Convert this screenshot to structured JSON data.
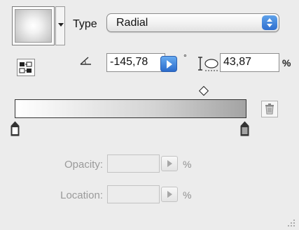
{
  "gradient": {
    "type_label": "Type",
    "type_value": "Radial",
    "angle_value": "-145,78",
    "angle_unit": "°",
    "radius_value": "43,87",
    "radius_unit": "%",
    "stops": [
      {
        "color": "#ffffff",
        "location_percent": 0
      },
      {
        "color": "#a3a3a3",
        "location_percent": 100
      }
    ],
    "midpoint_percent": 82
  },
  "stop_editor": {
    "opacity_label": "Opacity:",
    "opacity_value": "",
    "opacity_unit": "%",
    "location_label": "Location:",
    "location_value": "",
    "location_unit": "%"
  },
  "icons": {
    "swatch_menu": "chevron-down-icon",
    "swap": "reverse-gradient-icon",
    "angle": "angle-icon",
    "radius": "radius-icon",
    "delete": "trash-icon",
    "resize": "resize-grip-icon"
  },
  "colors": {
    "accent": "#2f6fcf",
    "panel_bg": "#ececec",
    "disabled_text": "#9a9a9a"
  }
}
